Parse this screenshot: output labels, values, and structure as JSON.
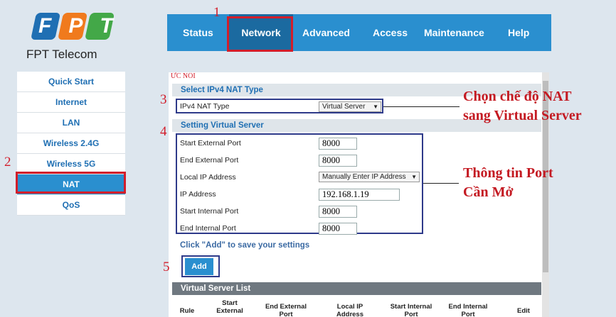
{
  "brand": {
    "name": "FPT",
    "sub": "FPT Telecom"
  },
  "nav": {
    "items": [
      "Status",
      "Network",
      "Advanced",
      "Access",
      "Maintenance",
      "Help"
    ]
  },
  "sidebar": {
    "items": [
      "Quick Start",
      "Internet",
      "LAN",
      "Wireless 2.4G",
      "Wireless 5G",
      "NAT",
      "QoS"
    ]
  },
  "steps": [
    "1",
    "2",
    "3",
    "4",
    "5"
  ],
  "panel": {
    "corner_text": "ỨC NỐI",
    "section1": "Select IPv4 NAT Type",
    "nat_type_label": "IPv4 NAT Type",
    "nat_type_value": "Virtual Server",
    "section2": "Setting Virtual Server",
    "fields": {
      "start_ext_label": "Start External Port",
      "start_ext_value": "8000",
      "end_ext_label": "End External Port",
      "end_ext_value": "8000",
      "local_ip_label": "Local IP Address",
      "local_ip_value": "Manually Enter IP Address",
      "ip_label": "IP Address",
      "ip_value": "192.168.1.19",
      "start_int_label": "Start Internal Port",
      "start_int_value": "8000",
      "end_int_label": "End Internal Port",
      "end_int_value": "8000"
    },
    "hint": "Click \"Add\" to save your settings",
    "add_button": "Add",
    "list_title": "Virtual Server List",
    "columns": [
      "Rule",
      "Start External",
      "End External Port",
      "Local IP Address",
      "Start Internal Port",
      "End Internal Port",
      "Edit"
    ]
  },
  "annotations": {
    "nat_line1": "Chọn chế độ NAT",
    "nat_line2": "sang Virtual Server",
    "port_line1": "Thông tin Port",
    "port_line2": "Cần Mở"
  },
  "colors": {
    "accent": "#2a8fcf",
    "highlight": "#d21e2b",
    "annotation": "#c41a22",
    "box": "#2e3a8a"
  }
}
